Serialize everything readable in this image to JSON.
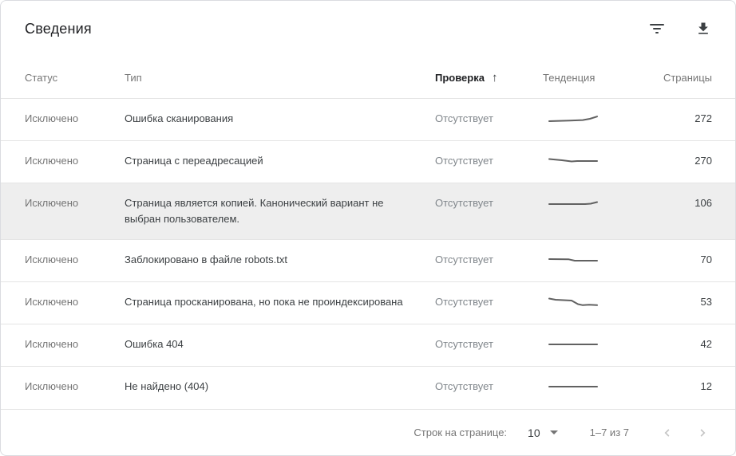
{
  "title": "Сведения",
  "toolbar": {
    "filter_icon": "filter-icon",
    "download_icon": "download-icon"
  },
  "table": {
    "columns": {
      "status": "Статус",
      "type": "Тип",
      "validation": "Проверка",
      "trend": "Тенденция",
      "pages": "Страницы"
    },
    "sort": {
      "column": "Проверка",
      "direction": "ascending",
      "arrow": "↑"
    },
    "rows": [
      {
        "status": "Исключено",
        "type": "Ошибка сканирования",
        "validation": "Отсутствует",
        "pages": "272",
        "highlighted": false,
        "trend": [
          [
            2,
            10
          ],
          [
            28,
            9.2
          ],
          [
            44,
            8.6
          ],
          [
            53,
            7
          ],
          [
            62,
            4.2
          ]
        ]
      },
      {
        "status": "Исключено",
        "type": "Страница с переадресацией",
        "validation": "Отсутствует",
        "pages": "270",
        "highlighted": false,
        "trend": [
          [
            2,
            4.5
          ],
          [
            18,
            6
          ],
          [
            30,
            7.5
          ],
          [
            37,
            7
          ],
          [
            62,
            7
          ]
        ]
      },
      {
        "status": "Исключено",
        "type": "Страница является копией. Канонический вариант не выбран пользователем.",
        "validation": "Отсутствует",
        "pages": "106",
        "highlighted": true,
        "trend": [
          [
            2,
            8
          ],
          [
            47,
            8
          ],
          [
            54,
            7.5
          ],
          [
            62,
            5.5
          ]
        ]
      },
      {
        "status": "Исключено",
        "type": "Заблокировано в файле robots.txt",
        "validation": "Отсутствует",
        "pages": "70",
        "highlighted": false,
        "trend": [
          [
            2,
            6
          ],
          [
            26,
            6.2
          ],
          [
            34,
            8
          ],
          [
            62,
            8
          ]
        ]
      },
      {
        "status": "Исключено",
        "type": "Страница просканирована, но пока не проиндексирована",
        "validation": "Отсутствует",
        "pages": "53",
        "highlighted": false,
        "trend": [
          [
            2,
            2.5
          ],
          [
            10,
            4
          ],
          [
            30,
            5
          ],
          [
            38,
            9.5
          ],
          [
            44,
            10.8
          ],
          [
            52,
            10.2
          ],
          [
            62,
            10.8
          ]
        ]
      },
      {
        "status": "Исключено",
        "type": "Ошибка 404",
        "validation": "Отсутствует",
        "pages": "42",
        "highlighted": false,
        "trend": [
          [
            2,
            7
          ],
          [
            62,
            7
          ]
        ]
      },
      {
        "status": "Исключено",
        "type": "Не найдено (404)",
        "validation": "Отсутствует",
        "pages": "12",
        "highlighted": false,
        "trend": [
          [
            2,
            7
          ],
          [
            62,
            7
          ]
        ]
      }
    ]
  },
  "footer": {
    "rows_per_page_label": "Строк на странице:",
    "rows_per_page_value": "10",
    "range_label": "1–7 из 7"
  },
  "colors": {
    "sparkline": "#616161",
    "row_highlight": "#eeeeee",
    "divider": "#e4e4e4",
    "text_primary": "#3c4043",
    "text_secondary": "#757575"
  }
}
